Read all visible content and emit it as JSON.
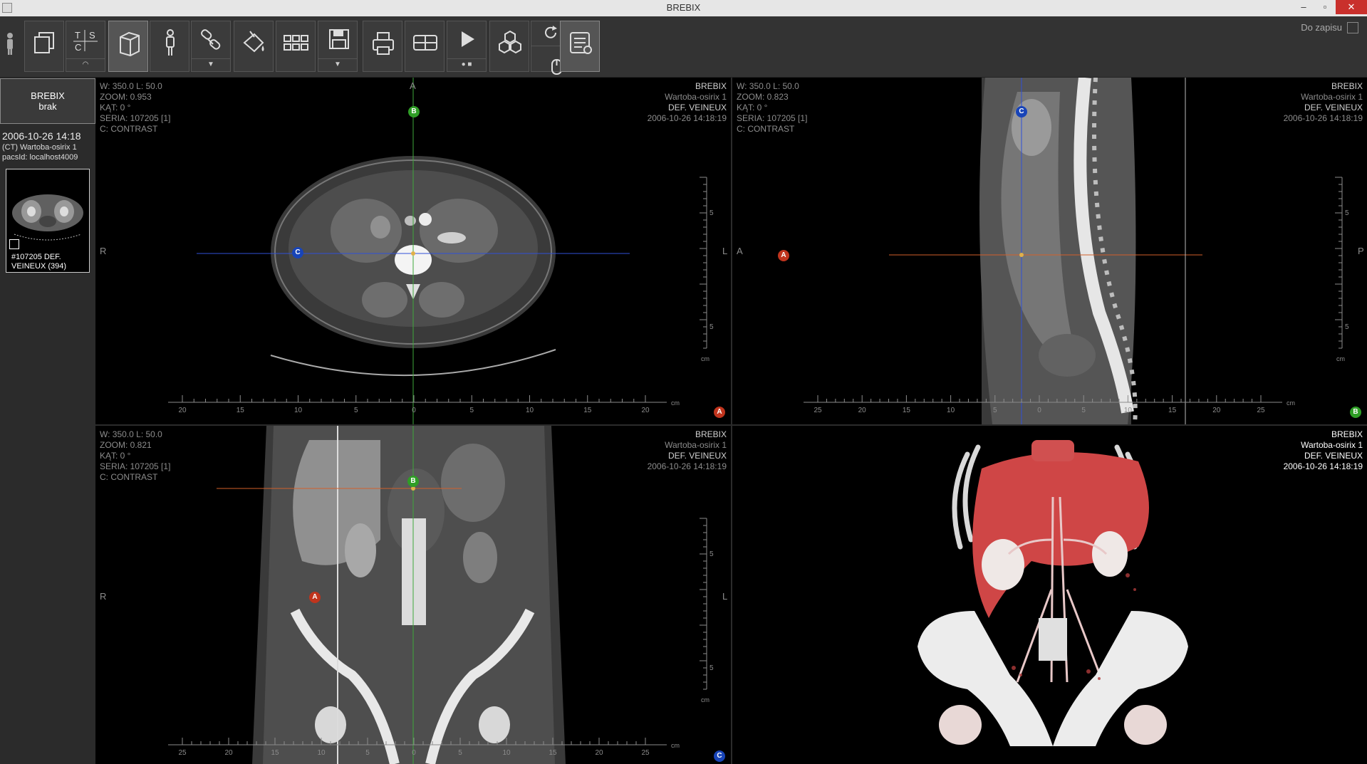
{
  "window": {
    "title": "BREBIX",
    "minimize": "–",
    "restore": "▫",
    "close": "✕"
  },
  "toolbar": {
    "buttons": [
      {
        "name": "person-icon"
      },
      {
        "name": "copy-windows-icon"
      },
      {
        "name": "tsc-layout-icon",
        "label": "T S C"
      },
      {
        "name": "cube-3d-icon"
      },
      {
        "name": "body-figure-icon"
      },
      {
        "name": "link-icon"
      },
      {
        "name": "paint-bucket-icon"
      },
      {
        "name": "grid-layout-icon"
      },
      {
        "name": "save-icon"
      },
      {
        "name": "print-icon"
      },
      {
        "name": "split-layout-icon"
      },
      {
        "name": "play-icon"
      },
      {
        "name": "molecule-icon"
      },
      {
        "name": "rotate-icon"
      },
      {
        "name": "mouse-icon"
      },
      {
        "name": "report-icon"
      }
    ],
    "do_zapisu": "Do zapisu"
  },
  "sidebar": {
    "patient_line1": "BREBIX",
    "patient_line2": "brak",
    "study_datetime": "2006-10-26  14:18",
    "study_name": "(CT) Wartoba-osirix 1",
    "pacs_label": "pacsId:  localhost4009",
    "thumb_caption_1": "#107205 DEF.",
    "thumb_caption_2": "VEINEUX (394)"
  },
  "viewports": {
    "axial": {
      "wl": "W: 350.0  L: 50.0",
      "zoom": "ZOOM: 0.953",
      "kat": "KĄT: 0 °",
      "seria": "SERIA: 107205 [1]",
      "contrast": "C: CONTRAST",
      "brand": "BREBIX",
      "study": "Wartoba-osirix 1",
      "series_name": "DEF. VEINEUX",
      "datetime": "2006-10-26 14:18:19",
      "orient_top": "A",
      "orient_left": "R",
      "orient_right": "L",
      "badge": "A",
      "scale_labels": [
        "20",
        "15",
        "10",
        "5",
        "0",
        "5",
        "10",
        "15",
        "20"
      ],
      "scale_unit": "cm",
      "vscale_labels": [
        "5",
        "5"
      ],
      "vscale_unit": "cm"
    },
    "sagittal": {
      "wl": "W: 350.0  L: 50.0",
      "zoom": "ZOOM: 0.823",
      "kat": "KĄT: 0 °",
      "seria": "SERIA: 107205 [1]",
      "contrast": "C: CONTRAST",
      "brand": "BREBIX",
      "study": "Wartoba-osirix 1",
      "series_name": "DEF. VEINEUX",
      "datetime": "2006-10-26 14:18:19",
      "orient_left": "A",
      "orient_right": "P",
      "badge": "B",
      "scale_labels": [
        "25",
        "20",
        "15",
        "10",
        "5",
        "0",
        "5",
        "10",
        "15",
        "20",
        "25"
      ],
      "scale_unit": "cm",
      "vscale_labels": [
        "5",
        "5"
      ],
      "vscale_unit": "cm"
    },
    "coronal": {
      "wl": "W: 350.0  L: 50.0",
      "zoom": "ZOOM: 0.821",
      "kat": "KĄT: 0 °",
      "seria": "SERIA: 107205 [1]",
      "contrast": "C: CONTRAST",
      "brand": "BREBIX",
      "study": "Wartoba-osirix 1",
      "series_name": "DEF. VEINEUX",
      "datetime": "2006-10-26 14:18:19",
      "orient_left": "R",
      "orient_right": "L",
      "badge": "C",
      "scale_labels": [
        "25",
        "20",
        "15",
        "10",
        "5",
        "0",
        "5",
        "10",
        "15",
        "20",
        "25"
      ],
      "scale_unit": "cm",
      "vscale_labels": [
        "5",
        "5"
      ],
      "vscale_unit": "cm"
    },
    "volume": {
      "brand": "BREBIX",
      "study": "Wartoba-osirix 1",
      "series_name": "DEF. VEINEUX",
      "datetime": "2006-10-26 14:18:19"
    }
  },
  "crosshair_markers": {
    "a": "A",
    "b": "B",
    "c": "C"
  },
  "colors": {
    "line_a": "#d2602a",
    "line_b": "#3ea83a",
    "line_c": "#2f50d8"
  }
}
